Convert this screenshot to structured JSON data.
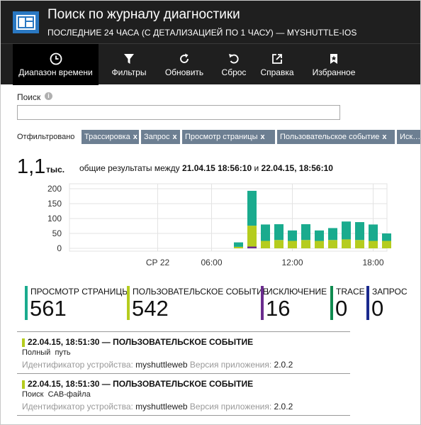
{
  "header": {
    "title": "Поиск по журналу диагностики",
    "subtitle": "ПОСЛЕДНИЕ 24 ЧАСА (С ДЕТАЛИЗАЦИЕЙ ПО 1 ЧАСУ) — MYSHUTTLE-IOS",
    "logo_color": "#2a78c2",
    "toolbar": [
      {
        "label": "Диапазон времени",
        "icon": "clock-icon",
        "active": true
      },
      {
        "label": "Фильтры",
        "icon": "filter-icon",
        "active": false
      },
      {
        "label": "Обновить",
        "icon": "refresh-icon",
        "active": false
      },
      {
        "label": "Сброс",
        "icon": "undo-icon",
        "active": false
      },
      {
        "label": "Справка",
        "icon": "external-link-icon",
        "active": false
      },
      {
        "label": "Избранное",
        "icon": "bookmark-star-icon",
        "active": false
      }
    ]
  },
  "search": {
    "label": "Поиск",
    "value": "",
    "placeholder": ""
  },
  "filters": {
    "label": "Отфильтровано",
    "chips": [
      {
        "label": "Трассировка",
        "close": "x"
      },
      {
        "label": "Запрос",
        "close": "x"
      },
      {
        "label": "Просмотр страницы",
        "close": "x"
      },
      {
        "label": "Пользовательское событие",
        "close": "x"
      },
      {
        "label": "Иск…",
        "close": ""
      }
    ]
  },
  "totals": {
    "value": "1,1",
    "unit": "тыс.",
    "desc_prefix": "общие результаты между",
    "from": "21.04.15 18:56:10",
    "conj": "и",
    "to": "22.04.15, 18:56:10"
  },
  "chart_data": {
    "type": "bar",
    "stacked": true,
    "y_ticks": [
      200,
      150,
      100,
      50,
      0
    ],
    "ylim": [
      0,
      215
    ],
    "x_tick_labels": [
      {
        "label": "СР 22",
        "hour": 2.5
      },
      {
        "label": "06:00",
        "hour": 6.5
      },
      {
        "label": "12:00",
        "hour": 12.5
      },
      {
        "label": "18:00",
        "hour": 18.5
      }
    ],
    "hours": [
      8,
      9,
      10,
      11,
      12,
      13,
      14,
      15,
      16,
      17,
      18,
      19
    ],
    "series": [
      {
        "name": "Исключение",
        "color": "#6a2c8e",
        "values": [
          0,
          6,
          0,
          0,
          0,
          0,
          0,
          0,
          0,
          0,
          0,
          0
        ]
      },
      {
        "name": "Пользовательское событие",
        "color": "#b5cc1e",
        "values": [
          5,
          70,
          25,
          28,
          25,
          28,
          25,
          28,
          30,
          28,
          25,
          25
        ]
      },
      {
        "name": "Просмотр страницы",
        "color": "#1aab8e",
        "values": [
          15,
          117,
          55,
          53,
          35,
          53,
          35,
          40,
          60,
          60,
          55,
          25
        ]
      }
    ],
    "grid": true,
    "grid_color": "#e3e3e3"
  },
  "categories": [
    {
      "name": "ПРОСМОТР СТРАНИЦЫ",
      "count": "561",
      "color": "#1aab8e"
    },
    {
      "name": "ПОЛЬЗОВАТЕЛЬСКОЕ СОБЫТИЕ",
      "count": "542",
      "color": "#b5cc1e"
    },
    {
      "name": "ИСКЛЮЧЕНИЕ",
      "count": "16",
      "color": "#6a2c8e"
    },
    {
      "name": "TRACE",
      "count": "0",
      "color": "#0f8a4f"
    },
    {
      "name": "ЗАПРОС",
      "count": "0",
      "color": "#1a2a8e"
    }
  ],
  "events": [
    {
      "title": "22.04.15, 18:51:30 — ПОЛЬЗОВАТЕЛЬСКОЕ СОБЫТИЕ",
      "detail": "Полный  путь",
      "device_label": "Идентификатор устройства:",
      "device": "myshuttleweb",
      "version_label": "Версия приложения:",
      "version": "2.0.2"
    },
    {
      "title": "22.04.15, 18:51:30 — ПОЛЬЗОВАТЕЛЬСКОЕ СОБЫТИЕ",
      "detail": "Поиск  CAB-файла",
      "device_label": "Идентификатор устройства:",
      "device": "myshuttleweb",
      "version_label": "Версия приложения:",
      "version": "2.0.2"
    }
  ]
}
